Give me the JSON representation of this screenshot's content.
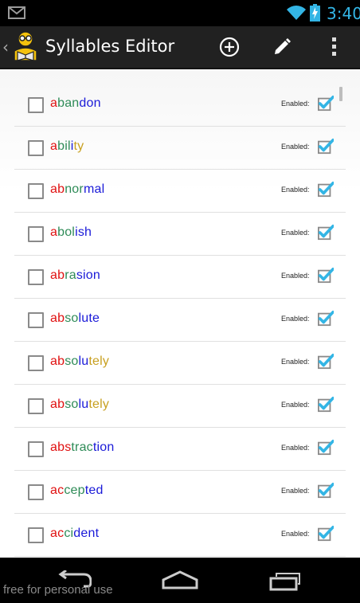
{
  "status_bar": {
    "time": "3:40",
    "notification_icon": "gmail-icon",
    "wifi_icon": "wifi-icon",
    "battery_icon": "battery-charging-icon"
  },
  "action_bar": {
    "title": "Syllables Editor",
    "up_caret": "‹",
    "app_icon": "reader-icon",
    "actions": [
      "add-icon",
      "edit-icon",
      "overflow-menu-icon"
    ]
  },
  "colors": {
    "red": "#e01010",
    "green": "#2e8b57",
    "blue": "#1a1ad8",
    "gold": "#c8a020",
    "check_blue": "#33b5e5"
  },
  "enabled_label": "Enabled:",
  "items": [
    {
      "word": "abandon",
      "syllables": [
        {
          "t": "a",
          "c": "red"
        },
        {
          "t": "ban",
          "c": "green"
        },
        {
          "t": "don",
          "c": "blue"
        }
      ],
      "selected": false,
      "enabled": true
    },
    {
      "word": "ability",
      "syllables": [
        {
          "t": "a",
          "c": "red"
        },
        {
          "t": "bil",
          "c": "green"
        },
        {
          "t": "i",
          "c": "blue"
        },
        {
          "t": "ty",
          "c": "gold"
        }
      ],
      "selected": false,
      "enabled": true
    },
    {
      "word": "abnormal",
      "syllables": [
        {
          "t": "ab",
          "c": "red"
        },
        {
          "t": "nor",
          "c": "green"
        },
        {
          "t": "mal",
          "c": "blue"
        }
      ],
      "selected": false,
      "enabled": true
    },
    {
      "word": "abolish",
      "syllables": [
        {
          "t": "a",
          "c": "red"
        },
        {
          "t": "bol",
          "c": "green"
        },
        {
          "t": "ish",
          "c": "blue"
        }
      ],
      "selected": false,
      "enabled": true
    },
    {
      "word": "abrasion",
      "syllables": [
        {
          "t": "ab",
          "c": "red"
        },
        {
          "t": "ra",
          "c": "green"
        },
        {
          "t": "sion",
          "c": "blue"
        }
      ],
      "selected": false,
      "enabled": true
    },
    {
      "word": "absolute",
      "syllables": [
        {
          "t": "ab",
          "c": "red"
        },
        {
          "t": "so",
          "c": "green"
        },
        {
          "t": "lute",
          "c": "blue"
        }
      ],
      "selected": false,
      "enabled": true
    },
    {
      "word": "absolutely",
      "syllables": [
        {
          "t": "ab",
          "c": "red"
        },
        {
          "t": "so",
          "c": "green"
        },
        {
          "t": "lu",
          "c": "blue"
        },
        {
          "t": "tely",
          "c": "gold"
        }
      ],
      "selected": false,
      "enabled": true
    },
    {
      "word": "absolutely",
      "syllables": [
        {
          "t": "ab",
          "c": "red"
        },
        {
          "t": "so",
          "c": "green"
        },
        {
          "t": "lu",
          "c": "blue"
        },
        {
          "t": "tely",
          "c": "gold"
        }
      ],
      "selected": false,
      "enabled": true
    },
    {
      "word": "abstraction",
      "syllables": [
        {
          "t": "abs",
          "c": "red"
        },
        {
          "t": "trac",
          "c": "green"
        },
        {
          "t": "tion",
          "c": "blue"
        }
      ],
      "selected": false,
      "enabled": true
    },
    {
      "word": "accepted",
      "syllables": [
        {
          "t": "ac",
          "c": "red"
        },
        {
          "t": "cep",
          "c": "green"
        },
        {
          "t": "ted",
          "c": "blue"
        }
      ],
      "selected": false,
      "enabled": true
    },
    {
      "word": "accident",
      "syllables": [
        {
          "t": "ac",
          "c": "red"
        },
        {
          "t": "ci",
          "c": "green"
        },
        {
          "t": "dent",
          "c": "blue"
        }
      ],
      "selected": false,
      "enabled": true
    }
  ],
  "nav_bar": {
    "buttons": [
      "back-icon",
      "home-icon",
      "recent-apps-icon"
    ],
    "watermark": "free for personal use"
  }
}
